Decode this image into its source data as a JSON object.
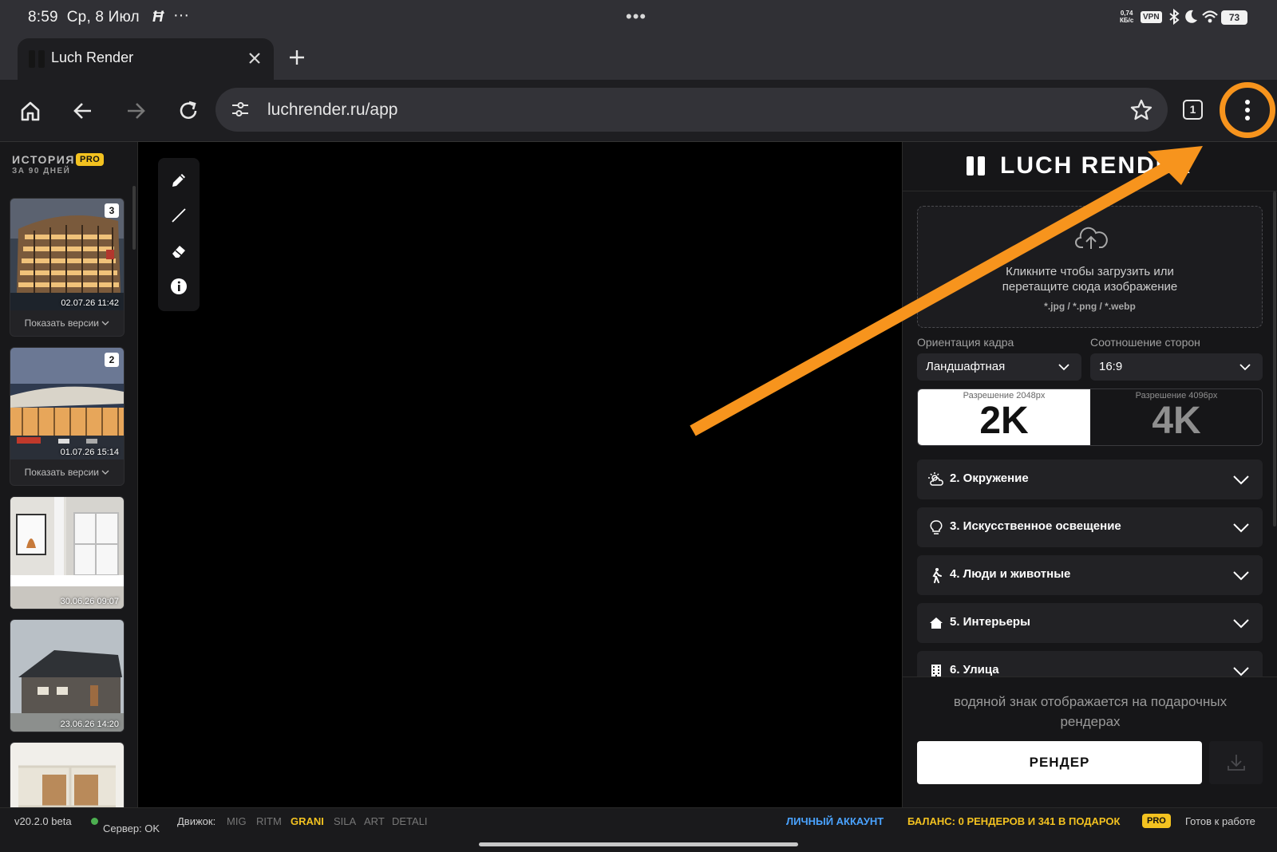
{
  "status_bar": {
    "time": "8:59",
    "date": "Ср, 8 Июл",
    "net_speed_value": "0,74",
    "net_speed_unit": "КБ/с",
    "vpn": "VPN",
    "battery": "73"
  },
  "browser": {
    "tab_title": "Luch Render",
    "url": "luchrender.ru/app",
    "tab_count": "1"
  },
  "history": {
    "title": "ИСТОРИЯ",
    "subtitle": "ЗА 90 ДНЕЙ",
    "pro_badge": "PRO",
    "items": [
      {
        "timestamp": "02.07.26 11:42",
        "versions_count": "3",
        "versions_label": "Показать версии"
      },
      {
        "timestamp": "01.07.26 15:14",
        "versions_count": "2",
        "versions_label": "Показать версии"
      },
      {
        "timestamp": "30.06.26 09:07"
      },
      {
        "timestamp": "23.06.26 14:20"
      }
    ]
  },
  "tools": [
    "pencil-icon",
    "line-icon",
    "eraser-icon",
    "info-icon"
  ],
  "panel": {
    "brand": "LUCH RENDER",
    "upload": {
      "text": "Кликните чтобы загрузить или перетащите сюда изображение",
      "formats": "*.jpg / *.png / *.webp"
    },
    "orientation": {
      "label": "Ориентация кадра",
      "value": "Ландшафтная"
    },
    "aspect": {
      "label": "Соотношение сторон",
      "value": "16:9"
    },
    "resolution": {
      "options": [
        {
          "sub": "Разрешение 2048px",
          "label": "2K",
          "selected": true
        },
        {
          "sub": "Разрешение 4096px",
          "label": "4K",
          "selected": false
        }
      ]
    },
    "sections": [
      {
        "label": "2. Окружение",
        "icon": "weather-icon"
      },
      {
        "label": "3. Искусственное освещение",
        "icon": "lightbulb-icon"
      },
      {
        "label": "4. Люди и животные",
        "icon": "walking-person-icon"
      },
      {
        "label": "5. Интерьеры",
        "icon": "house-icon"
      },
      {
        "label": "6. Улица",
        "icon": "building-icon"
      }
    ],
    "watermark_note": "водяной знак отображается на подарочных рендерах",
    "render_button": "РЕНДЕР"
  },
  "footer": {
    "version": "v20.2.0 beta",
    "server": "Сервер: OK",
    "engine_label": "Движок:",
    "engines": [
      "MIG",
      "RITM",
      "GRANI",
      "SILA",
      "ART",
      "DETALI"
    ],
    "active_engine": "GRANI",
    "account": "ЛИЧНЫЙ АККАУНТ",
    "balance": "БАЛАНС: 0 РЕНДЕРОВ И 341 В ПОДАРОК",
    "pro": "PRO",
    "status": "Готов к работе"
  },
  "colors": {
    "accent_orange": "#f7941d",
    "pro_yellow": "#f3c220",
    "account_blue": "#4aa3ff",
    "server_ok_green": "#4caf50"
  }
}
